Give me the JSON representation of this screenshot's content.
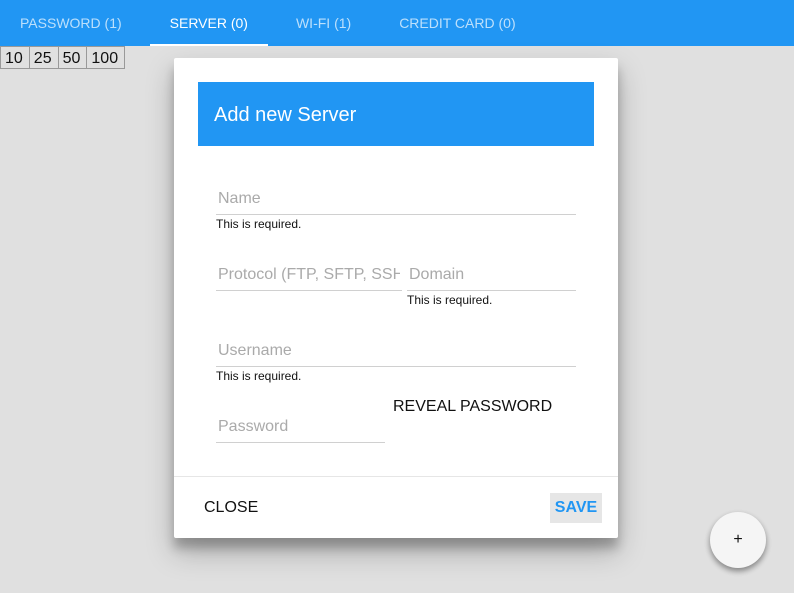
{
  "tabs": [
    {
      "label": "PASSWORD (1)"
    },
    {
      "label": "SERVER (0)"
    },
    {
      "label": "WI-FI (1)"
    },
    {
      "label": "CREDIT CARD (0)"
    }
  ],
  "active_tab": "SERVER (0)",
  "pager": [
    "10",
    "25",
    "50",
    "100"
  ],
  "dialog": {
    "title": "Add new Server",
    "fields": {
      "name": {
        "placeholder": "Name",
        "value": "",
        "error": "This is required."
      },
      "protocol": {
        "placeholder": "Protocol (FTP, SFTP, SSH)",
        "value": ""
      },
      "domain": {
        "placeholder": "Domain",
        "value": "",
        "error": "This is required."
      },
      "username": {
        "placeholder": "Username",
        "value": "",
        "error": "This is required."
      },
      "password": {
        "placeholder": "Password",
        "value": ""
      }
    },
    "reveal_label": "REVEAL PASSWORD",
    "close_label": "CLOSE",
    "save_label": "SAVE"
  },
  "fab": {
    "label": "+"
  },
  "colors": {
    "primary": "#2196f3",
    "background": "#e0e0e0"
  }
}
